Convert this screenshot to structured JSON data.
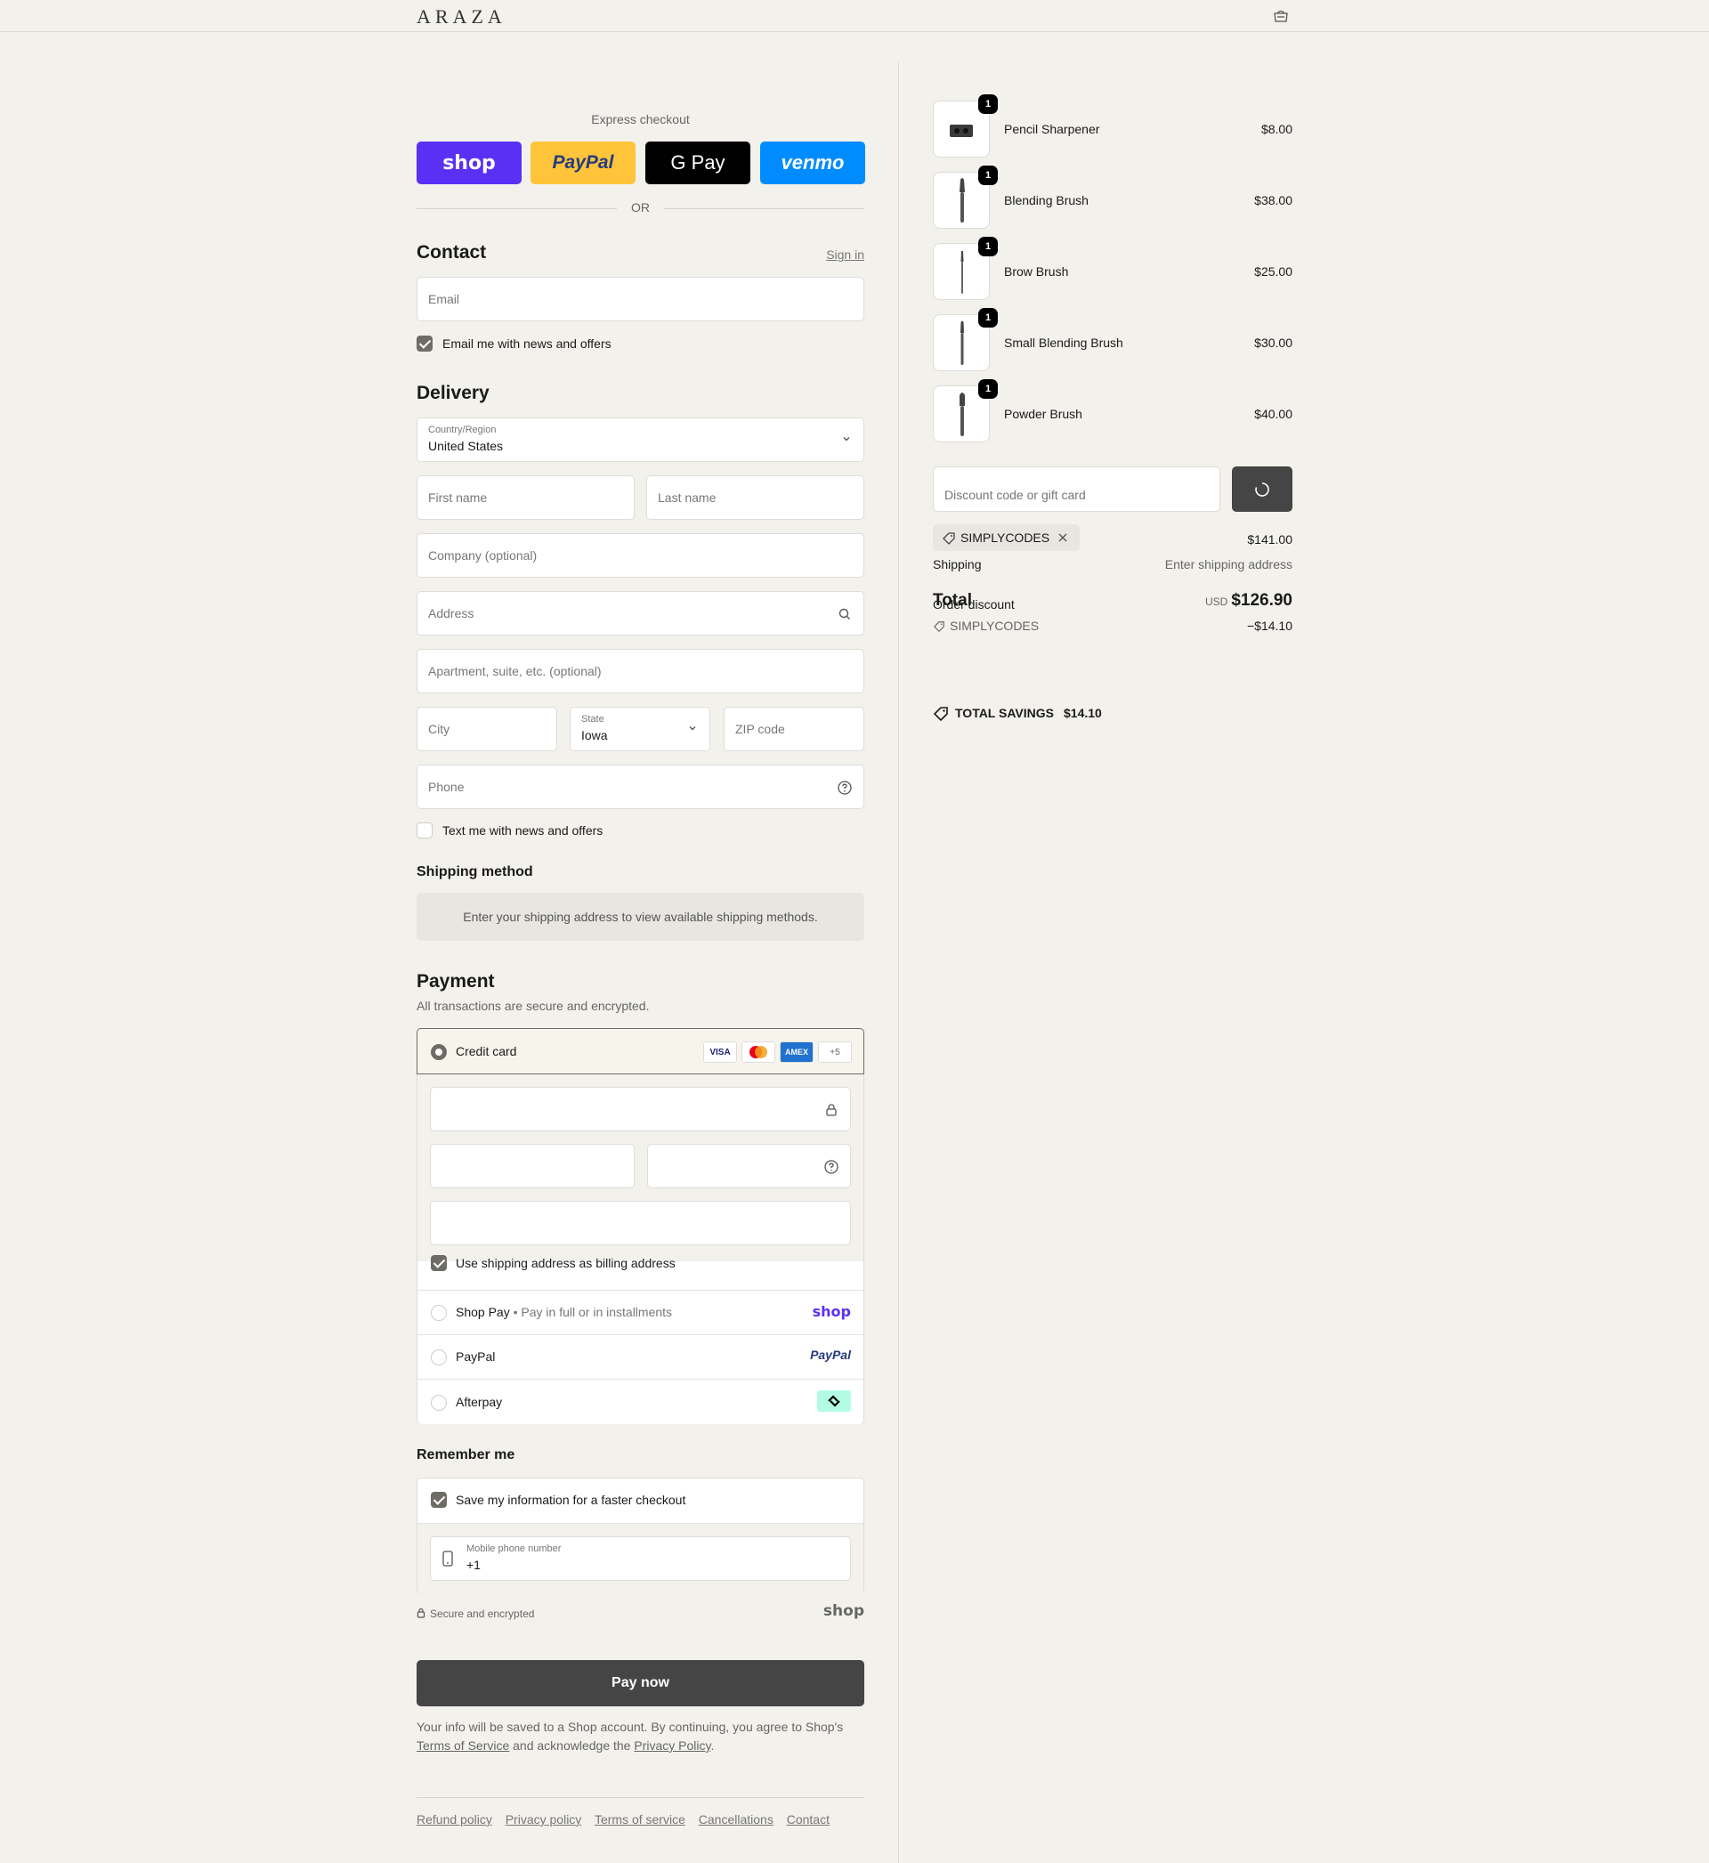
{
  "header": {
    "logo": "ARAZA"
  },
  "express": {
    "label": "Express checkout",
    "shop": "shop",
    "paypal": "PayPal",
    "gpay": "G Pay",
    "venmo": "venmo",
    "or": "OR"
  },
  "contact": {
    "title": "Contact",
    "sign_in": "Sign in",
    "email_placeholder": "Email",
    "news_label": "Email me with news and offers",
    "news_checked": true
  },
  "delivery": {
    "title": "Delivery",
    "country_label": "Country/Region",
    "country_value": "United States",
    "first_name": "First name",
    "last_name": "Last name",
    "company": "Company (optional)",
    "address": "Address",
    "apartment": "Apartment, suite, etc. (optional)",
    "city": "City",
    "state_label": "State",
    "state_value": "Iowa",
    "zip": "ZIP code",
    "phone": "Phone",
    "text_label": "Text me with news and offers"
  },
  "shipping_method": {
    "title": "Shipping method",
    "message": "Enter your shipping address to view available shipping methods."
  },
  "payment": {
    "title": "Payment",
    "subtitle": "All transactions are secure and encrypted.",
    "credit_card": "Credit card",
    "card_logos": [
      "VISA",
      "MC",
      "AMEX",
      "+5"
    ],
    "billing_label": "Use shipping address as billing address",
    "shop_pay": "Shop Pay",
    "shop_pay_sub": "Pay in full or in installments",
    "shop_logo": "shop",
    "paypal": "PayPal",
    "paypal_logo": "PayPal",
    "afterpay": "Afterpay"
  },
  "remember": {
    "title": "Remember me",
    "save_label": "Save my information for a faster checkout",
    "mobile_label": "Mobile phone number",
    "mobile_value": "+1",
    "secure": "Secure and encrypted",
    "shop_logo": "shop"
  },
  "pay_now": "Pay now",
  "legal": {
    "text1": "Your info will be saved to a Shop account. By continuing, you agree to Shop's",
    "terms": "Terms of Service",
    "text2": "and acknowledge the",
    "privacy": "Privacy Policy",
    "end": "."
  },
  "footer": [
    "Refund policy",
    "Privacy policy",
    "Terms of service",
    "Cancellations",
    "Contact"
  ],
  "cart": {
    "items": [
      {
        "name": "Pencil Sharpener",
        "price": "$8.00",
        "qty": "1"
      },
      {
        "name": "Blending Brush",
        "price": "$38.00",
        "qty": "1"
      },
      {
        "name": "Brow Brush",
        "price": "$25.00",
        "qty": "1"
      },
      {
        "name": "Small Blending Brush",
        "price": "$30.00",
        "qty": "1"
      },
      {
        "name": "Powder Brush",
        "price": "$40.00",
        "qty": "1"
      }
    ],
    "discount_placeholder": "Discount code or gift card",
    "applied_code": "SIMPLYCODES",
    "subtotal": "$141.00",
    "shipping_label": "Shipping",
    "shipping_value": "Enter shipping address",
    "order_discount_label": "Order discount",
    "discount_code": "SIMPLYCODES",
    "discount_value": "−$14.10",
    "total_label": "Total",
    "currency": "USD",
    "total": "$126.90",
    "savings_label": "TOTAL SAVINGS",
    "savings_value": "$14.10"
  }
}
